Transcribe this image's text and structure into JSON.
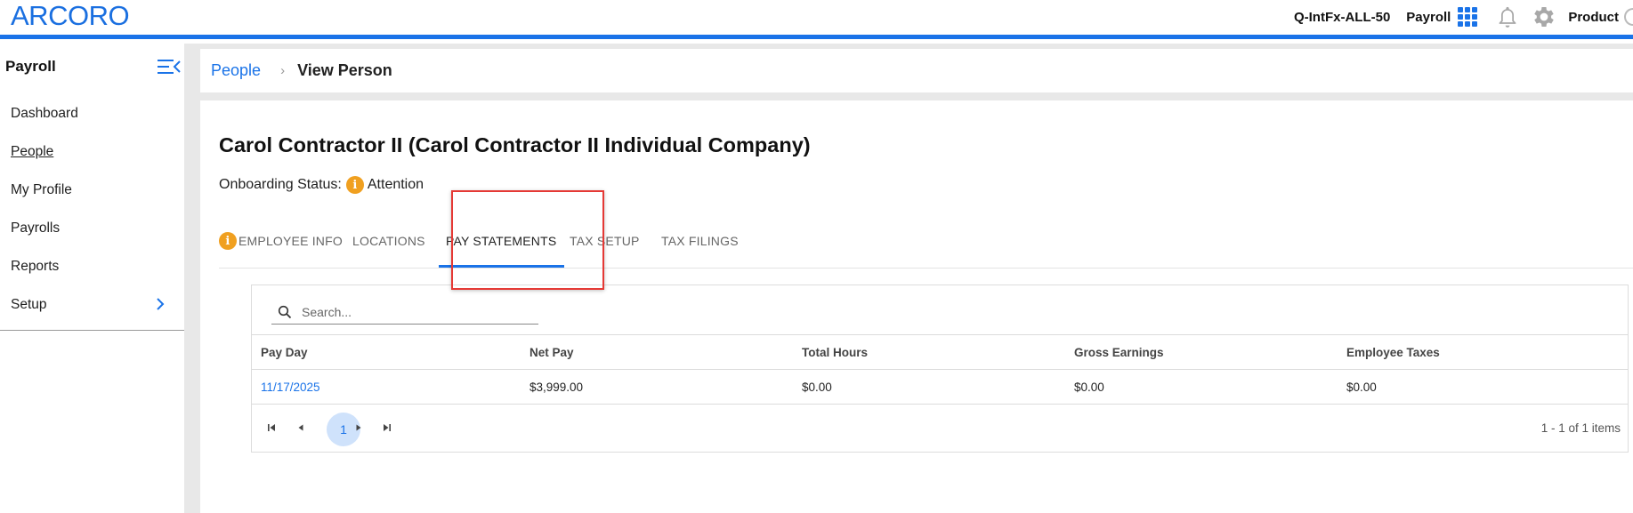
{
  "header": {
    "logo": "ARCORO",
    "org": "Q-IntFx-ALL-50",
    "app": "Payroll",
    "user": "Product",
    "icons": [
      "apps-grid-icon",
      "bell-icon",
      "gear-icon"
    ],
    "accent": "#1a73e8"
  },
  "sidebar": {
    "title": "Payroll",
    "items": [
      {
        "label": "Dashboard"
      },
      {
        "label": "People",
        "active": true
      },
      {
        "label": "My Profile"
      },
      {
        "label": "Payrolls"
      },
      {
        "label": "Reports"
      },
      {
        "label": "Setup",
        "has_submenu": true
      }
    ]
  },
  "breadcrumb": {
    "parent": "People",
    "separator": "›",
    "current": "View Person"
  },
  "person": {
    "title": "Carol Contractor II (Carol Contractor II Individual Company)",
    "status_label": "Onboarding Status:",
    "status_icon": "i",
    "status_value": "Attention"
  },
  "tabs": [
    {
      "label": "EMPLOYEE INFO",
      "warning": true
    },
    {
      "label": "LOCATIONS"
    },
    {
      "label": "PAY STATEMENTS",
      "active": true
    },
    {
      "label": "TAX SETUP"
    },
    {
      "label": "TAX FILINGS"
    }
  ],
  "grid": {
    "search_placeholder": "Search...",
    "columns": [
      "Pay Day",
      "Net Pay",
      "Total Hours",
      "Gross Earnings",
      "Employee Taxes"
    ],
    "rows": [
      [
        "11/17/2025",
        "$3,999.00",
        "$0.00",
        "$0.00",
        "$0.00"
      ]
    ],
    "pager": {
      "current_page": "1",
      "info": "1 - 1 of 1 items"
    }
  }
}
